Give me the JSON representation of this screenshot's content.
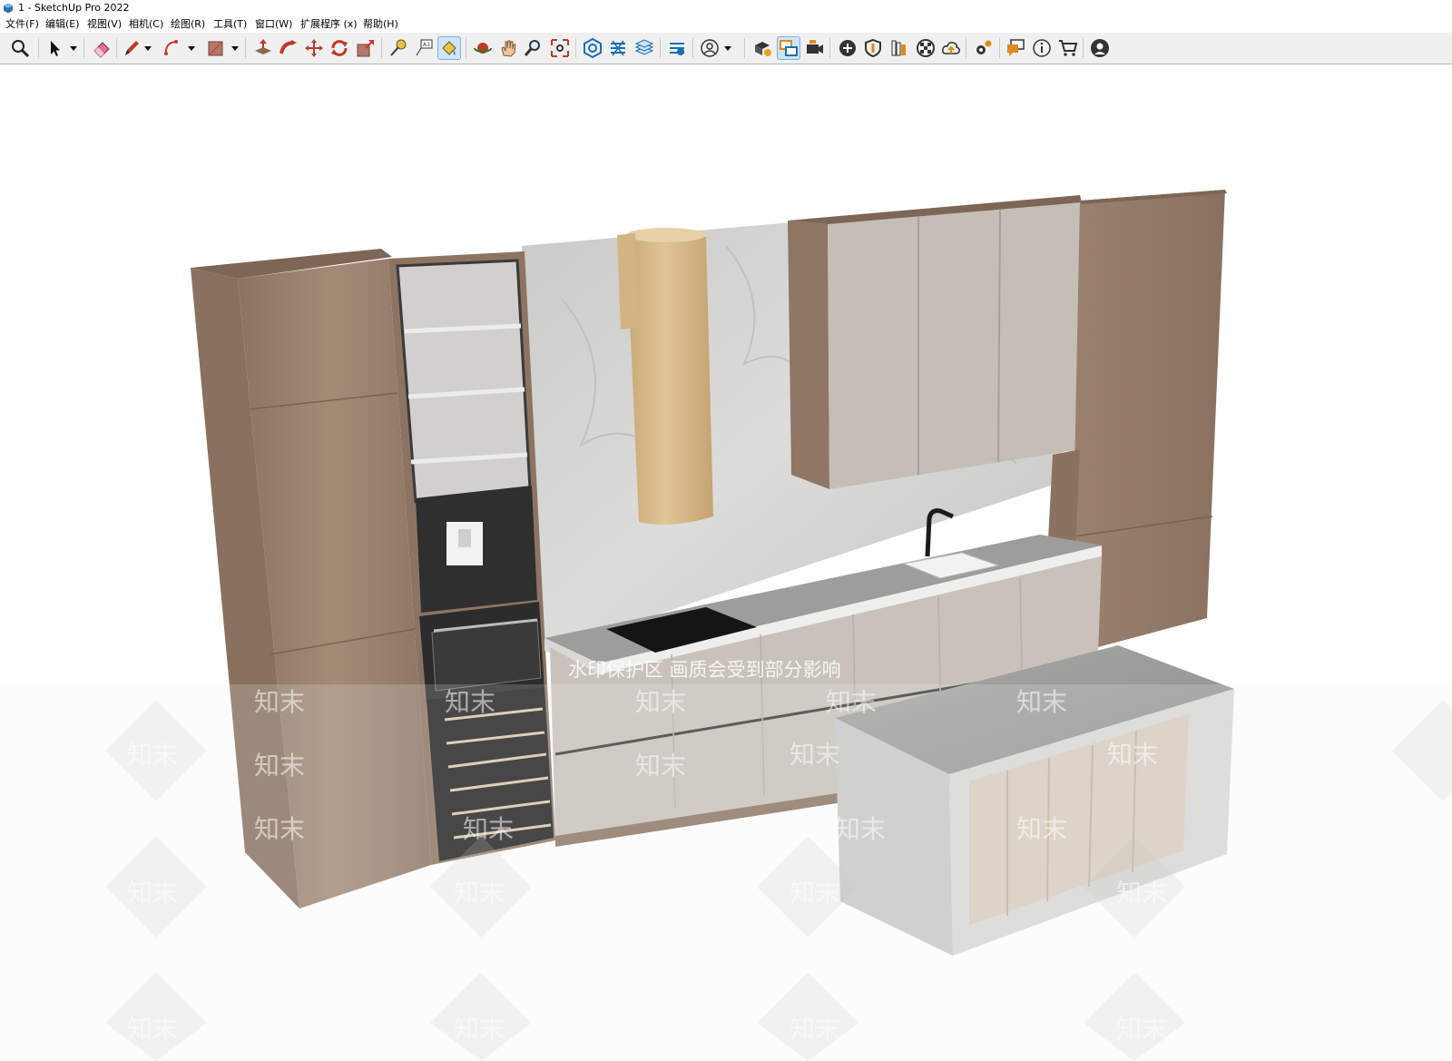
{
  "window": {
    "title": "1 - SketchUp Pro 2022"
  },
  "menu": [
    {
      "label": "文件(F)"
    },
    {
      "label": "编辑(E)"
    },
    {
      "label": "视图(V)"
    },
    {
      "label": "相机(C)"
    },
    {
      "label": "绘图(R)"
    },
    {
      "label": "工具(T)"
    },
    {
      "label": "窗口(W)"
    },
    {
      "label": "扩展程序 (x)"
    },
    {
      "label": "帮助(H)"
    }
  ],
  "toolbar": {
    "active_tools": [
      "paint-bucket-icon",
      "scenes-icon"
    ]
  },
  "viewport": {
    "watermark_banner": "水印保护区   画质会受到部分影响",
    "watermark_logo": "知末",
    "colors": {
      "wood": "#9c8370",
      "cabinet_light": "#c7bfb8",
      "hood": "#d7b98a",
      "marble": "#cdcdcc",
      "appliance_black": "#2f2f2f"
    }
  }
}
